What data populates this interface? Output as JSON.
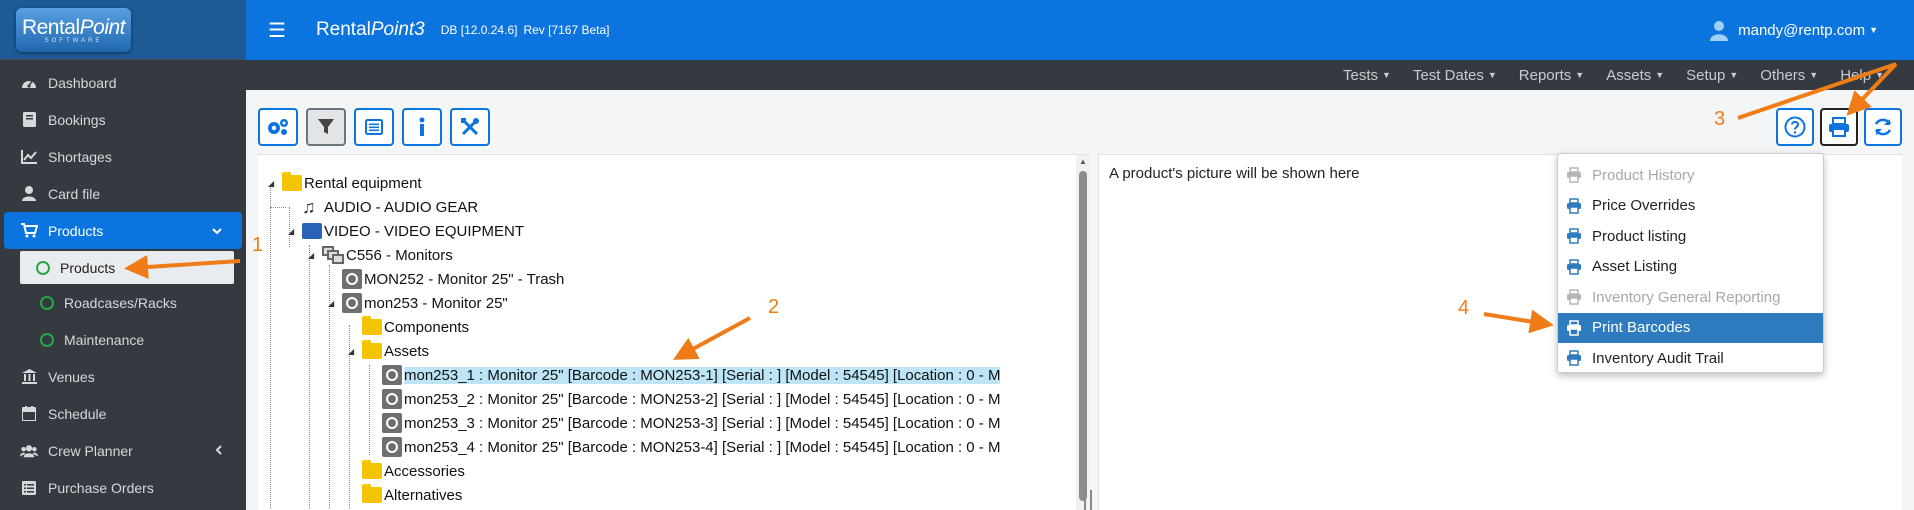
{
  "app": {
    "logo_main": "Rental",
    "logo_italic": "Point",
    "logo_sub": "SOFTWARE",
    "title_main": "Rental",
    "title_italic": "Point3",
    "db": "DB [12.0.24.6]",
    "rev": "Rev [7167 Beta]"
  },
  "user": {
    "email": "mandy@rentp.com",
    "icon": "user-icon"
  },
  "topmenu": [
    {
      "label": "Tests"
    },
    {
      "label": "Test Dates"
    },
    {
      "label": "Reports"
    },
    {
      "label": "Assets"
    },
    {
      "label": "Setup"
    },
    {
      "label": "Others"
    },
    {
      "label": "Help"
    }
  ],
  "sidebar": {
    "items": [
      {
        "label": "Dashboard",
        "icon": "dashboard-icon"
      },
      {
        "label": "Bookings",
        "icon": "book-icon"
      },
      {
        "label": "Shortages",
        "icon": "chart-icon"
      },
      {
        "label": "Card file",
        "icon": "user-icon"
      },
      {
        "label": "Products",
        "icon": "cart-icon"
      },
      {
        "label": "Venues",
        "icon": "building-icon"
      },
      {
        "label": "Schedule",
        "icon": "calendar-icon"
      },
      {
        "label": "Crew Planner",
        "icon": "users-icon"
      },
      {
        "label": "Purchase Orders",
        "icon": "list-icon"
      }
    ],
    "sub_items": [
      {
        "label": "Products"
      },
      {
        "label": "Roadcases/Racks"
      },
      {
        "label": "Maintenance"
      }
    ]
  },
  "tree": {
    "rows": [
      {
        "label": "Rental equipment"
      },
      {
        "label": "AUDIO - AUDIO GEAR"
      },
      {
        "label": "VIDEO - VIDEO EQUIPMENT"
      },
      {
        "label": "C556 - Monitors"
      },
      {
        "label": "MON252 - Monitor 25\" - Trash"
      },
      {
        "label": "mon253 - Monitor 25\""
      },
      {
        "label": "Components"
      },
      {
        "label": "Assets"
      },
      {
        "label": "mon253_1 : Monitor 25\" [Barcode : MON253-1] [Serial : ] [Model : 54545] [Location : 0 - M"
      },
      {
        "label": "mon253_2 : Monitor 25\" [Barcode : MON253-2] [Serial : ] [Model : 54545] [Location : 0 - M"
      },
      {
        "label": "mon253_3 : Monitor 25\" [Barcode : MON253-3] [Serial : ] [Model : 54545] [Location : 0 - M"
      },
      {
        "label": "mon253_4 : Monitor 25\" [Barcode : MON253-4] [Serial : ] [Model : 54545] [Location : 0 - M"
      },
      {
        "label": "Accessories"
      },
      {
        "label": "Alternatives"
      }
    ]
  },
  "picture_panel": {
    "text": "A product's picture will be shown here"
  },
  "print_menu": {
    "items": [
      {
        "label": "Product History",
        "disabled": true
      },
      {
        "label": "Price Overrides",
        "disabled": false
      },
      {
        "label": "Product listing",
        "disabled": false
      },
      {
        "label": "Asset Listing",
        "disabled": false
      },
      {
        "label": "Inventory General Reporting",
        "disabled": true
      },
      {
        "label": "Print Barcodes",
        "disabled": false,
        "active": true
      },
      {
        "label": "Inventory Audit Trail",
        "disabled": false
      }
    ]
  },
  "annotations": [
    "1",
    "2",
    "3",
    "4"
  ],
  "colors": {
    "primary": "#0b74de",
    "sidebar": "#343a40",
    "annotation": "#f07c18",
    "active_item": "#2e7bbf",
    "selected_row": "#bde4f7"
  }
}
